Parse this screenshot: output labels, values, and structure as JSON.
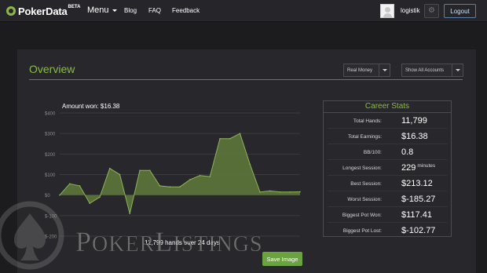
{
  "nav": {
    "logo_text": "PokerData",
    "logo_beta": "BETA",
    "menu_label": "Menu",
    "links": [
      "Blog",
      "FAQ",
      "Feedback"
    ],
    "username": "logistik",
    "logout_label": "Logout"
  },
  "overview": {
    "title": "Overview",
    "money_select": "Real Money",
    "account_select": "Show All Accounts",
    "amount_won": "Amount won: $16.38",
    "hands_caption": "11,799 hands over 24 days",
    "save_label": "Save Image"
  },
  "career_stats": {
    "title": "Career Stats",
    "rows": [
      {
        "label": "Total Hands:",
        "value": "11,799",
        "unit": ""
      },
      {
        "label": "Total Earnings:",
        "value": "$16.38",
        "unit": ""
      },
      {
        "label": "BB/100:",
        "value": "0.8",
        "unit": ""
      },
      {
        "label": "Longest Session:",
        "value": "229",
        "unit": "minutes"
      },
      {
        "label": "Best Session:",
        "value": "$213.12",
        "unit": ""
      },
      {
        "label": "Worst Session:",
        "value": "$-185.27",
        "unit": ""
      },
      {
        "label": "Biggest Pot Won:",
        "value": "$117.41",
        "unit": ""
      },
      {
        "label": "Biggest Pot Lost:",
        "value": "$-102.77",
        "unit": ""
      }
    ]
  },
  "chart_data": {
    "type": "area",
    "ytick_labels": [
      "$400",
      "$300",
      "$200",
      "$100",
      "$0",
      "$-100",
      "$-200"
    ],
    "yticks": [
      400,
      300,
      200,
      100,
      0,
      -100,
      -200
    ],
    "ylim": [
      -200,
      400
    ],
    "x": [
      0,
      1,
      2,
      3,
      4,
      5,
      6,
      7,
      8,
      9,
      10,
      11,
      12,
      13,
      14,
      15,
      16,
      17,
      18,
      19,
      20,
      21,
      22,
      23,
      24
    ],
    "values": [
      0,
      55,
      45,
      -40,
      -10,
      130,
      100,
      -90,
      120,
      120,
      45,
      40,
      40,
      75,
      95,
      90,
      275,
      275,
      300,
      150,
      15,
      20,
      15,
      15,
      16
    ],
    "fill_color": "#5f7a3c",
    "line_color": "#8fb35a",
    "grid": true
  },
  "watermark": {
    "text": "POKERLISTINGS"
  }
}
